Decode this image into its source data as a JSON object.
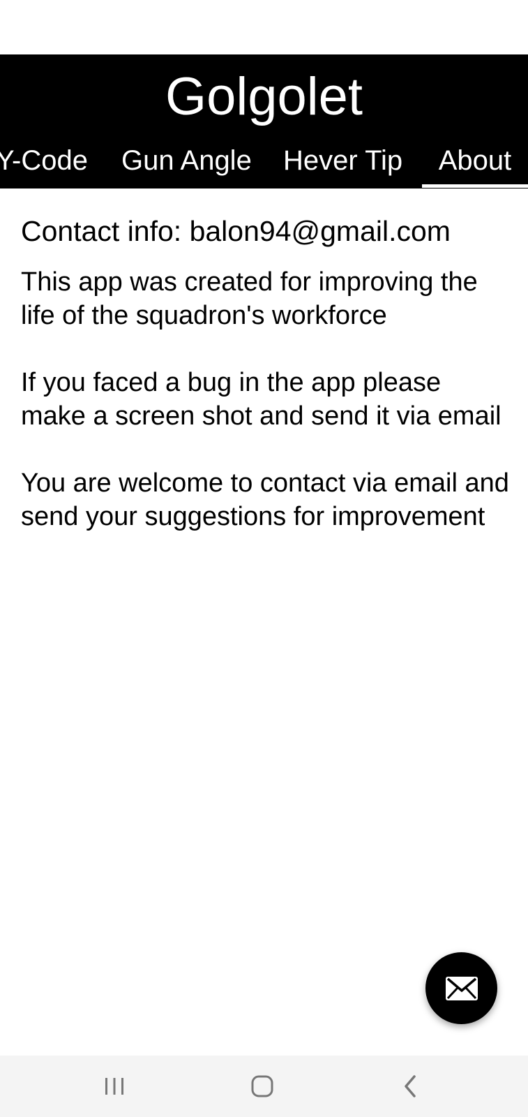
{
  "app": {
    "title": "Golgolet"
  },
  "tabs": [
    {
      "label": "Y-Code",
      "selected": false
    },
    {
      "label": "Gun Angle",
      "selected": false
    },
    {
      "label": "Hever Tip",
      "selected": false
    },
    {
      "label": "About",
      "selected": true
    }
  ],
  "about": {
    "contact_line": "Contact info: balon94@gmail.com",
    "paragraphs": [
      "This app was created for improving the life of the squadron's workforce",
      " If you faced a bug in the app please make a screen shot and send it via email",
      " You are welcome to contact via email and send your suggestions for improvement"
    ]
  },
  "fab": {
    "icon": "mail-icon"
  },
  "navigation_bar": {
    "icons": [
      "recent-apps-icon",
      "home-icon",
      "back-icon"
    ]
  },
  "colors": {
    "app_bar_background": "#000000",
    "app_bar_text": "#ffffff",
    "body_background": "#ffffff",
    "body_text": "#000000",
    "nav_bar_background": "#f4f4f4",
    "nav_icon": "#777777"
  }
}
